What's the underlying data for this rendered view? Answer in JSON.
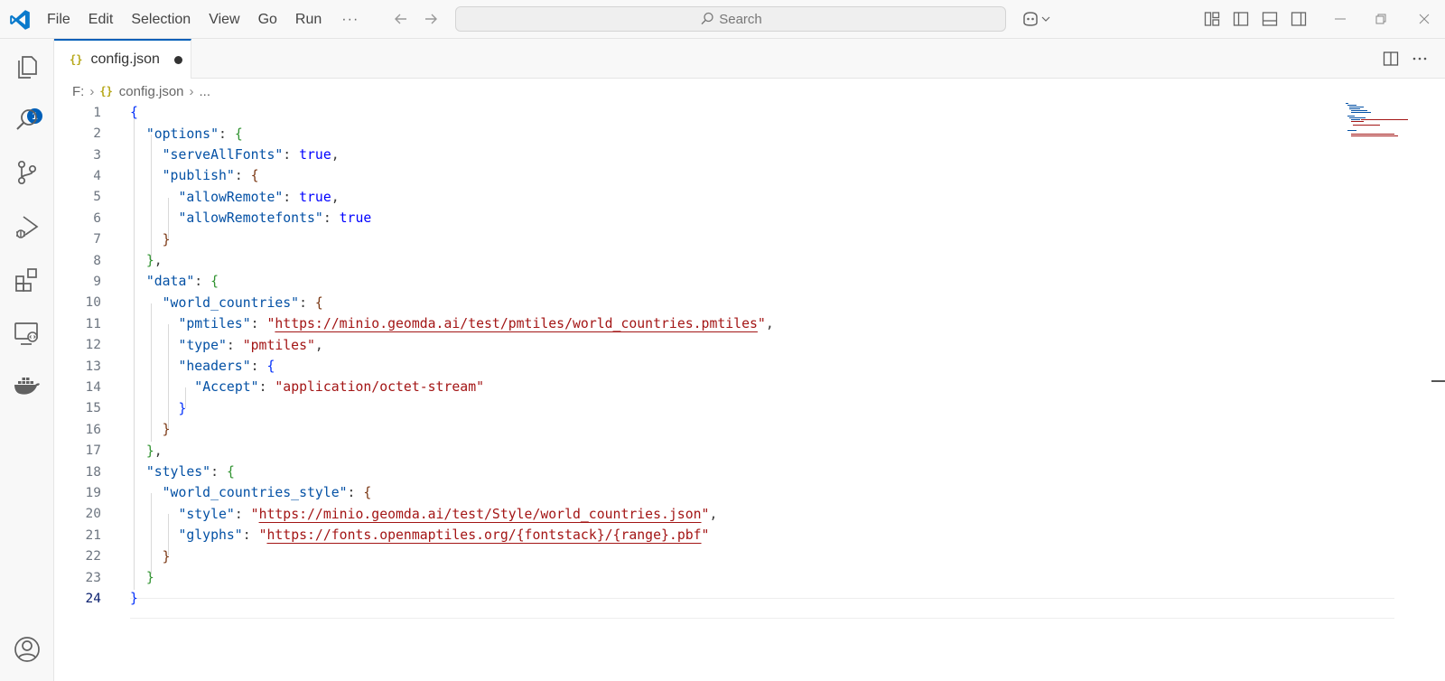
{
  "titlebar": {
    "menu": [
      "File",
      "Edit",
      "Selection",
      "View",
      "Go",
      "Run"
    ],
    "menu_more": "···",
    "search_placeholder": "Search"
  },
  "activity": {
    "explorer_badge": "1"
  },
  "tab": {
    "label": "config.json",
    "icon_text": "{}"
  },
  "breadcrumb": {
    "drive": "F:",
    "file": "config.json",
    "more": "..."
  },
  "editor": {
    "active_line": 24,
    "lines": [
      {
        "n": "1"
      },
      {
        "n": "2"
      },
      {
        "n": "3"
      },
      {
        "n": "4"
      },
      {
        "n": "5"
      },
      {
        "n": "6"
      },
      {
        "n": "7"
      },
      {
        "n": "8"
      },
      {
        "n": "9"
      },
      {
        "n": "10"
      },
      {
        "n": "11"
      },
      {
        "n": "12"
      },
      {
        "n": "13"
      },
      {
        "n": "14"
      },
      {
        "n": "15"
      },
      {
        "n": "16"
      },
      {
        "n": "17"
      },
      {
        "n": "18"
      },
      {
        "n": "19"
      },
      {
        "n": "20"
      },
      {
        "n": "21"
      },
      {
        "n": "22"
      },
      {
        "n": "23"
      },
      {
        "n": "24"
      }
    ],
    "tokens": {
      "options": "\"options\"",
      "serveAllFonts": "\"serveAllFonts\"",
      "publish": "\"publish\"",
      "allowRemote": "\"allowRemote\"",
      "allowRemotefonts": "\"allowRemotefonts\"",
      "true": "true",
      "data": "\"data\"",
      "world_countries": "\"world_countries\"",
      "pmtiles_key": "\"pmtiles\"",
      "pmtiles_url": "https://minio.geomda.ai/test/pmtiles/world_countries.pmtiles",
      "type_key": "\"type\"",
      "type_val": "\"pmtiles\"",
      "headers": "\"headers\"",
      "accept_key": "\"Accept\"",
      "accept_val": "\"application/octet-stream\"",
      "styles": "\"styles\"",
      "world_countries_style": "\"world_countries_style\"",
      "style_key": "\"style\"",
      "style_url": "https://minio.geomda.ai/test/Style/world_countries.json",
      "glyphs_key": "\"glyphs\"",
      "glyphs_url": "https://fonts.openmaptiles.org/{fontstack}/{range}.pbf"
    }
  },
  "colors": {
    "accent": "#005fb8",
    "json_key": "#0451a5",
    "json_string": "#a31515",
    "json_bool": "#0000ff"
  }
}
